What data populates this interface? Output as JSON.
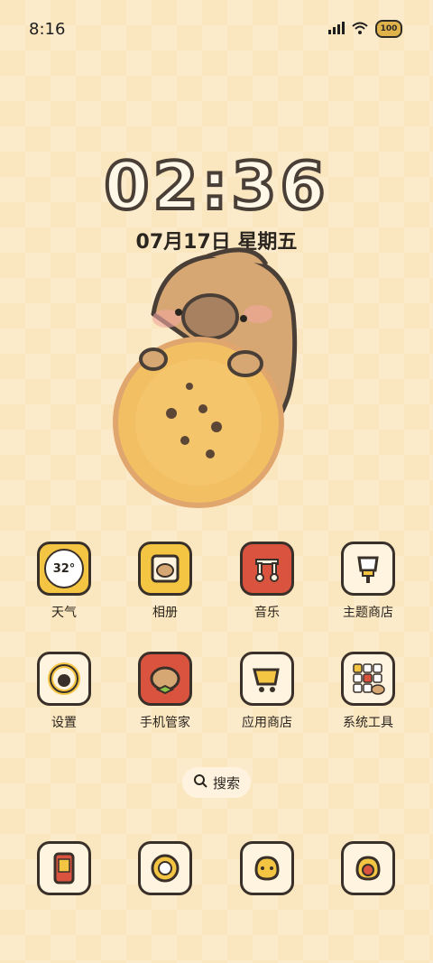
{
  "status_bar": {
    "time": "8:16",
    "battery": "100"
  },
  "lock_clock": {
    "time": "02:36",
    "date": "07月17日 星期五"
  },
  "apps": [
    {
      "label": "天气",
      "icon": "weather-icon",
      "icon_text": "32°"
    },
    {
      "label": "相册",
      "icon": "gallery-icon"
    },
    {
      "label": "音乐",
      "icon": "music-icon"
    },
    {
      "label": "主题商店",
      "icon": "theme-store-icon"
    },
    {
      "label": "设置",
      "icon": "settings-icon"
    },
    {
      "label": "手机管家",
      "icon": "phone-manager-icon"
    },
    {
      "label": "应用商店",
      "icon": "app-store-icon"
    },
    {
      "label": "系统工具",
      "icon": "system-tools-icon"
    }
  ],
  "search": {
    "label": "搜索"
  },
  "dock": [
    {
      "icon": "phone-icon"
    },
    {
      "icon": "camera-icon"
    },
    {
      "icon": "messages-icon"
    },
    {
      "icon": "browser-icon"
    }
  ],
  "colors": {
    "background": "#fbe7bf",
    "icon_outline": "#3a302a",
    "accent_red": "#d9533f",
    "accent_yellow": "#f4c542",
    "tile_cream": "#fff4df"
  }
}
